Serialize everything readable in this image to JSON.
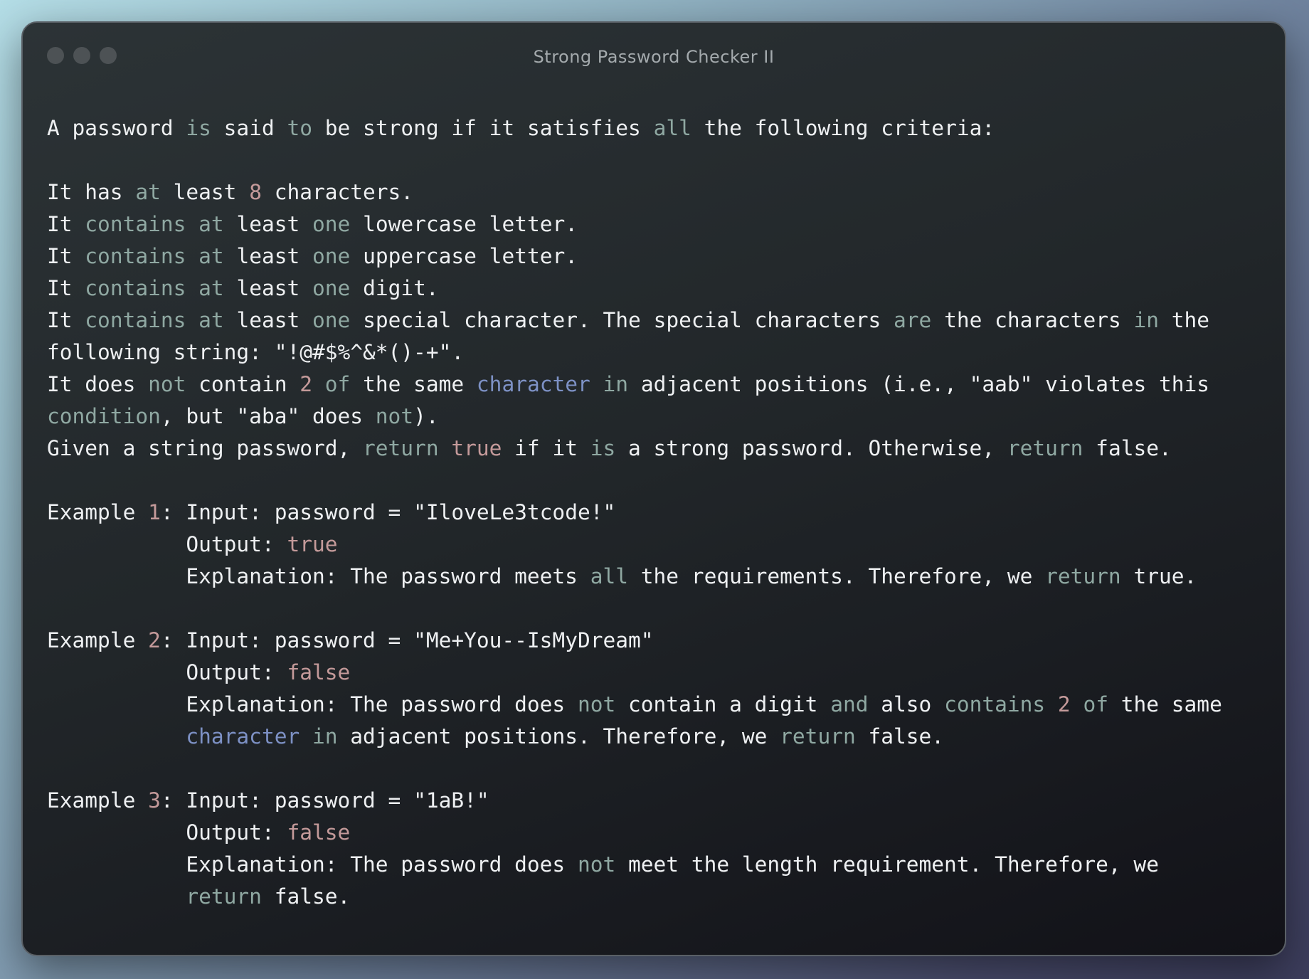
{
  "window": {
    "title": "Strong Password Checker II"
  },
  "colors": {
    "text": "#eef0f2",
    "keyword": "#8fa8a2",
    "number": "#c49a9a",
    "type": "#7d91c5",
    "title": "#a4aaad"
  },
  "lines": [
    [
      [
        "t",
        "A password "
      ],
      [
        "k",
        "is"
      ],
      [
        "t",
        " said "
      ],
      [
        "k",
        "to"
      ],
      [
        "t",
        " be strong if it satisfies "
      ],
      [
        "k",
        "all"
      ],
      [
        "t",
        " the following criteria:"
      ]
    ],
    [],
    [
      [
        "t",
        "It has "
      ],
      [
        "k",
        "at"
      ],
      [
        "t",
        " least "
      ],
      [
        "n",
        "8"
      ],
      [
        "t",
        " characters."
      ]
    ],
    [
      [
        "t",
        "It "
      ],
      [
        "k",
        "contains"
      ],
      [
        "t",
        " "
      ],
      [
        "k",
        "at"
      ],
      [
        "t",
        " least "
      ],
      [
        "k",
        "one"
      ],
      [
        "t",
        " lowercase letter."
      ]
    ],
    [
      [
        "t",
        "It "
      ],
      [
        "k",
        "contains"
      ],
      [
        "t",
        " "
      ],
      [
        "k",
        "at"
      ],
      [
        "t",
        " least "
      ],
      [
        "k",
        "one"
      ],
      [
        "t",
        " uppercase letter."
      ]
    ],
    [
      [
        "t",
        "It "
      ],
      [
        "k",
        "contains"
      ],
      [
        "t",
        " "
      ],
      [
        "k",
        "at"
      ],
      [
        "t",
        " least "
      ],
      [
        "k",
        "one"
      ],
      [
        "t",
        " digit."
      ]
    ],
    [
      [
        "t",
        "It "
      ],
      [
        "k",
        "contains"
      ],
      [
        "t",
        " "
      ],
      [
        "k",
        "at"
      ],
      [
        "t",
        " least "
      ],
      [
        "k",
        "one"
      ],
      [
        "t",
        " special character. The special characters "
      ],
      [
        "k",
        "are"
      ],
      [
        "t",
        " the characters "
      ],
      [
        "k",
        "in"
      ],
      [
        "t",
        " the"
      ]
    ],
    [
      [
        "t",
        "following string: \"!@#$%^&*()-+\"."
      ]
    ],
    [
      [
        "t",
        "It does "
      ],
      [
        "k",
        "not"
      ],
      [
        "t",
        " contain "
      ],
      [
        "n",
        "2"
      ],
      [
        "t",
        " "
      ],
      [
        "k",
        "of"
      ],
      [
        "t",
        " the same "
      ],
      [
        "y",
        "character"
      ],
      [
        "t",
        " "
      ],
      [
        "k",
        "in"
      ],
      [
        "t",
        " adjacent positions (i.e., \"aab\" violates this"
      ]
    ],
    [
      [
        "k",
        "condition"
      ],
      [
        "t",
        ", but \"aba\" does "
      ],
      [
        "k",
        "not"
      ],
      [
        "t",
        ")."
      ]
    ],
    [
      [
        "t",
        "Given a string password, "
      ],
      [
        "k",
        "return"
      ],
      [
        "t",
        " "
      ],
      [
        "n",
        "true"
      ],
      [
        "t",
        " if it "
      ],
      [
        "k",
        "is"
      ],
      [
        "t",
        " a strong password. Otherwise, "
      ],
      [
        "k",
        "return"
      ],
      [
        "t",
        " false."
      ]
    ],
    [],
    [
      [
        "t",
        "Example "
      ],
      [
        "n",
        "1"
      ],
      [
        "t",
        ": Input: password = \"IloveLe3tcode!\""
      ]
    ],
    [
      [
        "t",
        "           Output: "
      ],
      [
        "n",
        "true"
      ]
    ],
    [
      [
        "t",
        "           Explanation: The password meets "
      ],
      [
        "k",
        "all"
      ],
      [
        "t",
        " the requirements. Therefore, we "
      ],
      [
        "k",
        "return"
      ],
      [
        "t",
        " true."
      ]
    ],
    [],
    [
      [
        "t",
        "Example "
      ],
      [
        "n",
        "2"
      ],
      [
        "t",
        ": Input: password = \"Me+You--IsMyDream\""
      ]
    ],
    [
      [
        "t",
        "           Output: "
      ],
      [
        "n",
        "false"
      ]
    ],
    [
      [
        "t",
        "           Explanation: The password does "
      ],
      [
        "k",
        "not"
      ],
      [
        "t",
        " contain a digit "
      ],
      [
        "k",
        "and"
      ],
      [
        "t",
        " also "
      ],
      [
        "k",
        "contains"
      ],
      [
        "t",
        " "
      ],
      [
        "n",
        "2"
      ],
      [
        "t",
        " "
      ],
      [
        "k",
        "of"
      ],
      [
        "t",
        " the same"
      ]
    ],
    [
      [
        "t",
        "           "
      ],
      [
        "y",
        "character"
      ],
      [
        "t",
        " "
      ],
      [
        "k",
        "in"
      ],
      [
        "t",
        " adjacent positions. Therefore, we "
      ],
      [
        "k",
        "return"
      ],
      [
        "t",
        " false."
      ]
    ],
    [],
    [
      [
        "t",
        "Example "
      ],
      [
        "n",
        "3"
      ],
      [
        "t",
        ": Input: password = \"1aB!\""
      ]
    ],
    [
      [
        "t",
        "           Output: "
      ],
      [
        "n",
        "false"
      ]
    ],
    [
      [
        "t",
        "           Explanation: The password does "
      ],
      [
        "k",
        "not"
      ],
      [
        "t",
        " meet the length requirement. Therefore, we"
      ]
    ],
    [
      [
        "t",
        "           "
      ],
      [
        "k",
        "return"
      ],
      [
        "t",
        " false."
      ]
    ]
  ]
}
